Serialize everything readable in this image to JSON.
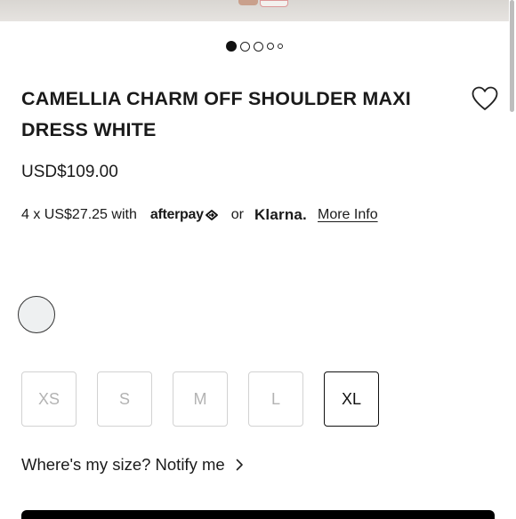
{
  "product": {
    "title": "CAMELLIA CHARM OFF SHOULDER MAXI DRESS WHITE",
    "price": "USD$109.00",
    "installment_text": "4 x US$27.25 with",
    "afterpay_label": "afterpay",
    "or_label": "or",
    "klarna_label": "Klarna.",
    "more_info_label": "More Info"
  },
  "gallery": {
    "total_images": 5,
    "active_index": 0
  },
  "color_swatch": {
    "color": "#eef0f1"
  },
  "sizes": [
    {
      "label": "XS",
      "available": false,
      "selected": false
    },
    {
      "label": "S",
      "available": false,
      "selected": false
    },
    {
      "label": "M",
      "available": false,
      "selected": false
    },
    {
      "label": "L",
      "available": false,
      "selected": false
    },
    {
      "label": "XL",
      "available": true,
      "selected": true
    }
  ],
  "notify": {
    "label": "Where's my size? Notify me"
  },
  "icons": {
    "wishlist": "heart-icon",
    "notify_arrow": "chevron-right-icon"
  }
}
